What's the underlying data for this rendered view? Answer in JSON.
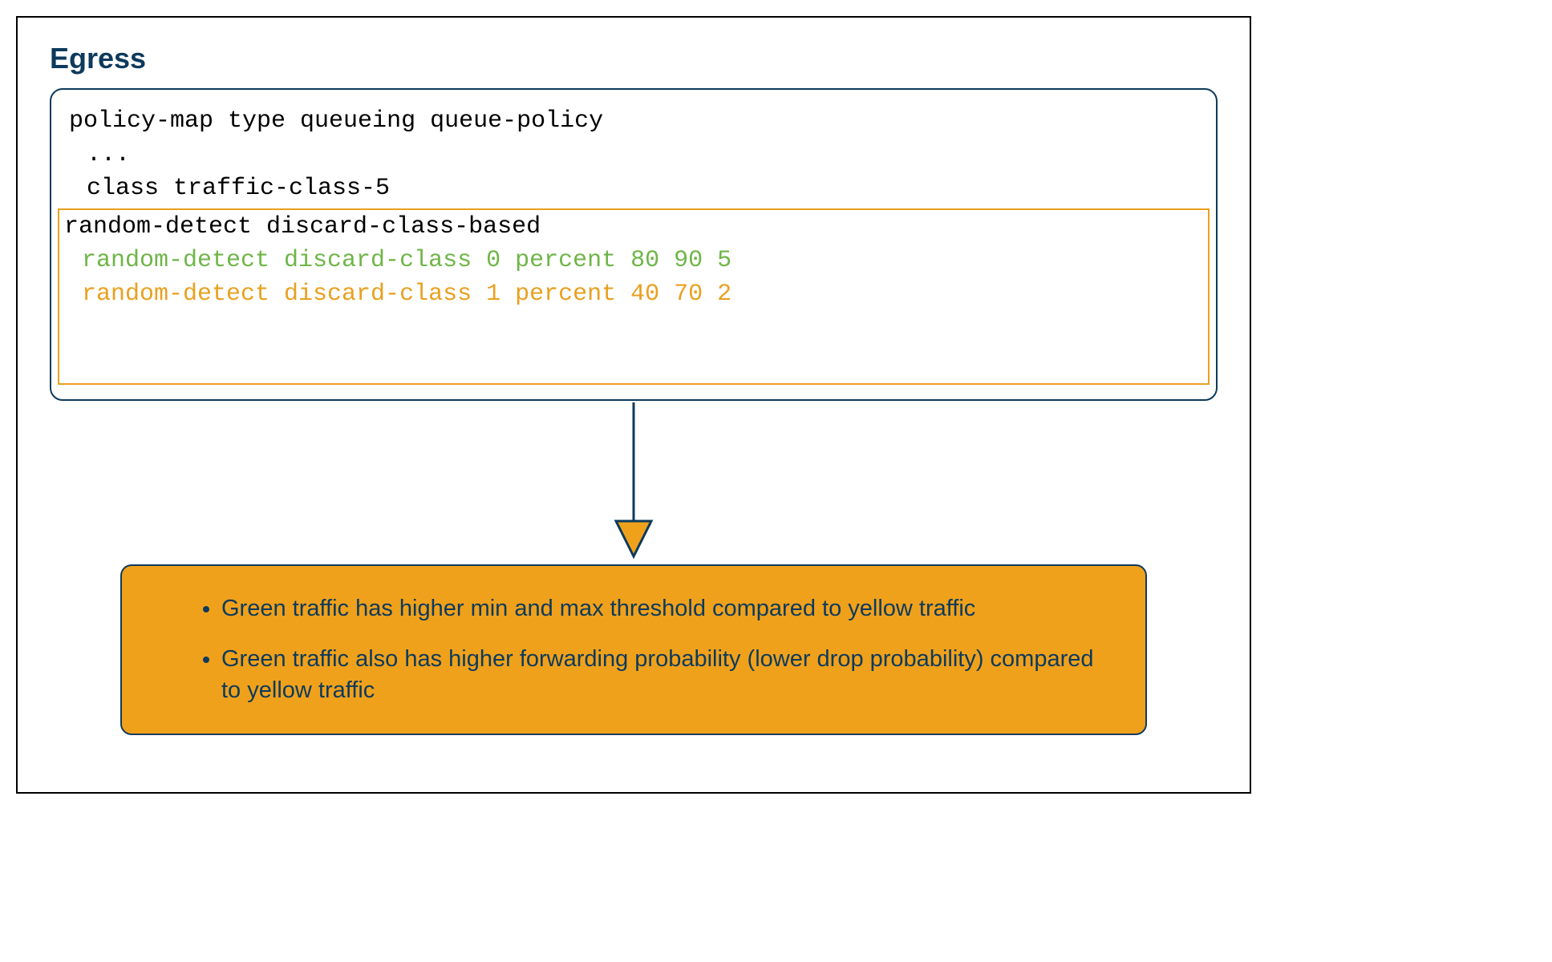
{
  "title": "Egress",
  "code": {
    "line1": "policy-map type queueing queue-policy",
    "ellipsis": "...",
    "line2": "class traffic-class-5",
    "hl_line1": "random-detect discard-class-based",
    "hl_line2": "random-detect discard-class 0 percent 80 90 5",
    "hl_line3": "random-detect discard-class 1 percent 40 70 2"
  },
  "info": {
    "bullet1": "Green traffic has higher min and max threshold compared to yellow traffic",
    "bullet2": "Green traffic also has higher forwarding probability (lower drop probability) compared to yellow traffic"
  },
  "colors": {
    "navy": "#0d3a5c",
    "orange": "#f0a11b",
    "orangeBorder": "#e9a01f",
    "green": "#6fb547"
  }
}
